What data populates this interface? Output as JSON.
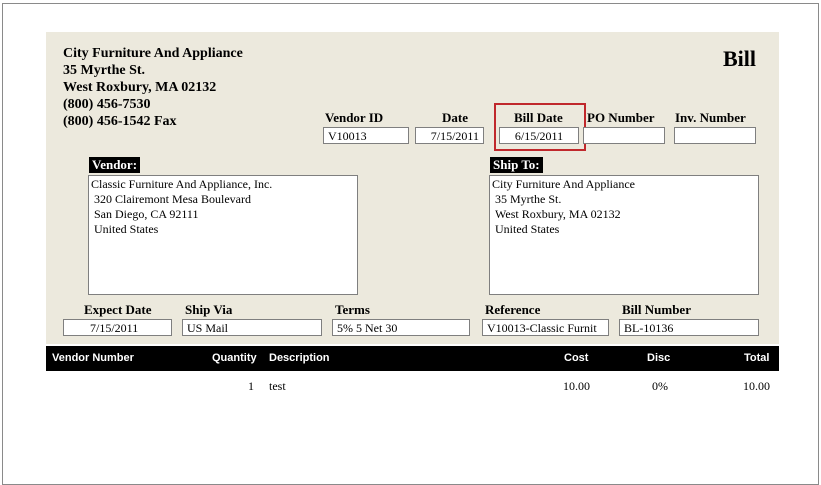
{
  "company": {
    "name": "City Furniture And Appliance",
    "street": "35 Myrthe St.",
    "city": "West Roxbury,  MA  02132",
    "phone": "(800) 456-7530",
    "fax": "(800) 456-1542 Fax"
  },
  "doc_title": "Bill",
  "fields": {
    "vendor_id_label": "Vendor ID",
    "vendor_id": "V10013",
    "date_label": "Date",
    "date": "7/15/2011",
    "bill_date_label": "Bill Date",
    "bill_date": "6/15/2011",
    "po_number_label": "PO Number",
    "po_number": "",
    "inv_number_label": "Inv. Number",
    "inv_number": ""
  },
  "vendor": {
    "label": "Vendor:",
    "lines": [
      "Classic Furniture And Appliance, Inc.",
      "320 Clairemont Mesa Boulevard",
      "San Diego,  CA  92111",
      "United States"
    ]
  },
  "ship_to": {
    "label": "Ship To:",
    "lines": [
      "City Furniture And Appliance",
      "35 Myrthe St.",
      "West Roxbury,  MA  02132",
      "United States"
    ]
  },
  "lower": {
    "expect_date_label": "Expect Date",
    "expect_date": "7/15/2011",
    "ship_via_label": "Ship Via",
    "ship_via": "US Mail",
    "terms_label": "Terms",
    "terms": "5% 5 Net 30",
    "reference_label": "Reference",
    "reference": "V10013-Classic Furnit",
    "bill_number_label": "Bill Number",
    "bill_number": "BL-10136"
  },
  "columns": {
    "vendor_number": "Vendor Number",
    "quantity": "Quantity",
    "description": "Description",
    "cost": "Cost",
    "disc": "Disc",
    "total": "Total"
  },
  "items": [
    {
      "vendor_number": "",
      "quantity": "1",
      "description": "test",
      "cost": "10.00",
      "disc": "0%",
      "total": "10.00"
    }
  ]
}
